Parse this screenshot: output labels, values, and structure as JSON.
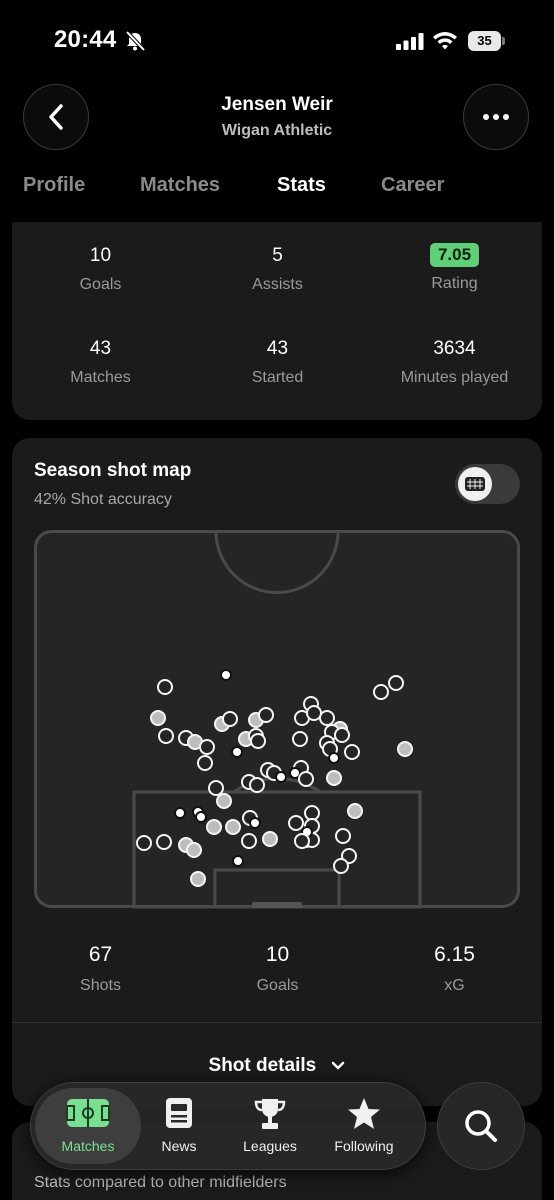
{
  "status": {
    "time": "20:44",
    "battery": "35",
    "icons": [
      "bell-slash-icon",
      "signal-icon",
      "wifi-icon",
      "battery-icon"
    ]
  },
  "header": {
    "player_name": "Jensen Weir",
    "team": "Wigan Athletic",
    "tabs": [
      {
        "label": "Profile",
        "active": false
      },
      {
        "label": "Matches",
        "active": false
      },
      {
        "label": "Stats",
        "active": true
      },
      {
        "label": "Career",
        "active": false
      }
    ]
  },
  "summary": {
    "goals": {
      "value": "10",
      "label": "Goals"
    },
    "assists": {
      "value": "5",
      "label": "Assists"
    },
    "rating": {
      "value": "7.05",
      "label": "Rating"
    },
    "matches": {
      "value": "43",
      "label": "Matches"
    },
    "started": {
      "value": "43",
      "label": "Started"
    },
    "minutes": {
      "value": "3634",
      "label": "Minutes played"
    }
  },
  "shot_map": {
    "title": "Season shot map",
    "subtitle": "42% Shot accuracy",
    "toggle_icon": "goal-net-icon",
    "stats": {
      "shots": {
        "value": "67",
        "label": "Shots"
      },
      "goals": {
        "value": "10",
        "label": "Goals"
      },
      "xg": {
        "value": "6.15",
        "label": "xG"
      }
    },
    "details_label": "Shot details"
  },
  "bottom_card": {
    "subtitle": "Stats compared to other midfielders"
  },
  "tabbar": {
    "items": [
      {
        "label": "Matches",
        "icon": "pitch-icon",
        "active": true
      },
      {
        "label": "News",
        "icon": "news-icon",
        "active": false
      },
      {
        "label": "Leagues",
        "icon": "trophy-icon",
        "active": false
      },
      {
        "label": "Following",
        "icon": "star-icon",
        "active": false
      }
    ],
    "search_icon": "search-icon"
  },
  "colors": {
    "accent_green": "#78e08f",
    "rating_green": "#5fcf78",
    "card_bg": "#1b1b1b"
  }
}
